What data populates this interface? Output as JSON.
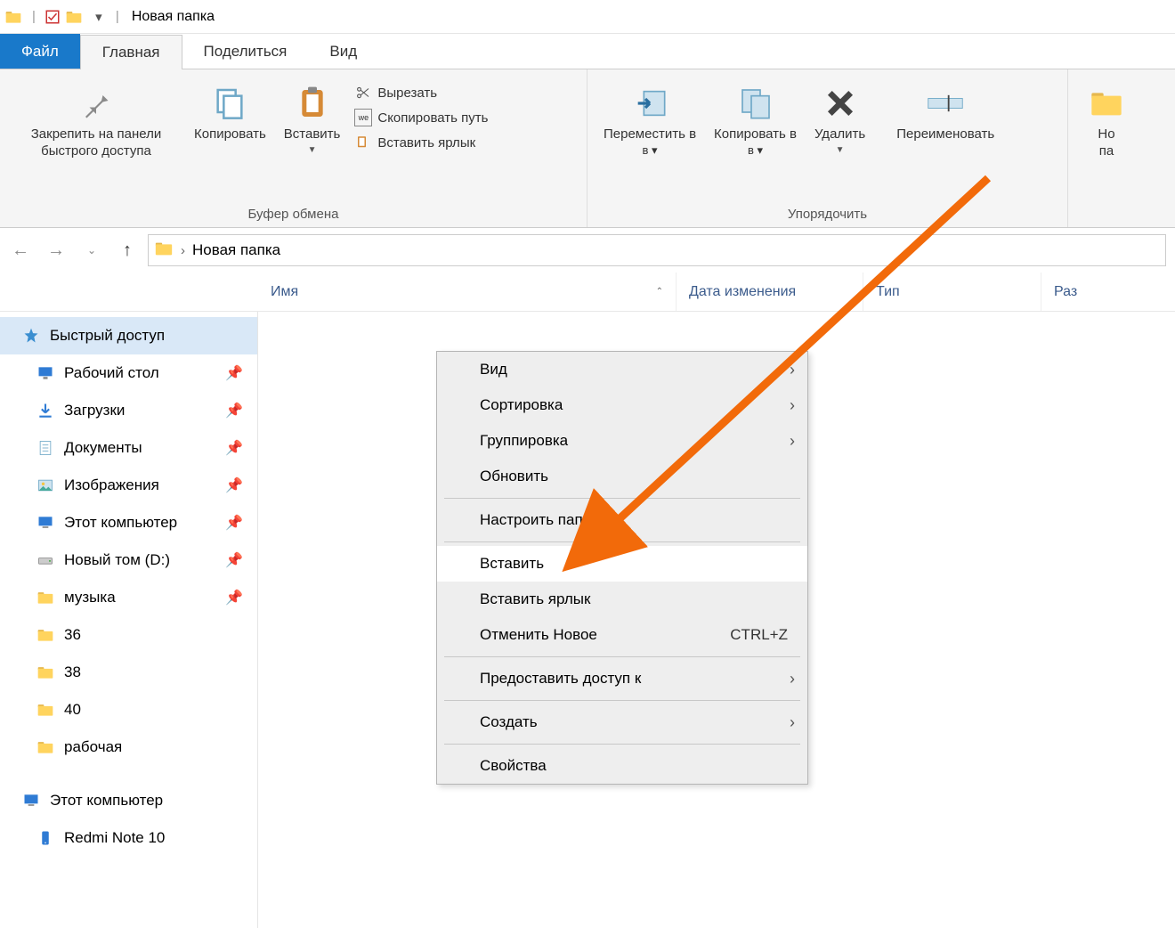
{
  "window": {
    "title": "Новая папка"
  },
  "tabs": {
    "file": "Файл",
    "home": "Главная",
    "share": "Поделиться",
    "view": "Вид"
  },
  "ribbon": {
    "clipboard": {
      "pin": "Закрепить на панели быстрого доступа",
      "copy": "Копировать",
      "paste": "Вставить",
      "cut": "Вырезать",
      "copy_path": "Скопировать путь",
      "paste_shortcut": "Вставить ярлык",
      "group_label": "Буфер обмена"
    },
    "organize": {
      "move_to": "Переместить в",
      "copy_to": "Копировать в",
      "delete": "Удалить",
      "rename": "Переименовать",
      "group_label": "Упорядочить"
    },
    "new": {
      "new_folder_partial": "Но",
      "new_folder_partial2": "па"
    }
  },
  "breadcrumb": {
    "current": "Новая папка"
  },
  "columns": {
    "name": "Имя",
    "date_modified": "Дата изменения",
    "type": "Тип",
    "size": "Раз"
  },
  "sidebar": {
    "quick_access": "Быстрый доступ",
    "desktop": "Рабочий стол",
    "downloads": "Загрузки",
    "documents": "Документы",
    "pictures": "Изображения",
    "this_pc_pinned": "Этот компьютер",
    "new_volume": "Новый том (D:)",
    "music": "музыка",
    "f36": "36",
    "f38": "38",
    "f40": "40",
    "work": "рабочая",
    "this_pc": "Этот компьютер",
    "phone": "Redmi Note 10"
  },
  "context_menu": {
    "view": "Вид",
    "sort": "Сортировка",
    "group": "Группировка",
    "refresh": "Обновить",
    "customize": "Настроить папку…",
    "paste": "Вставить",
    "paste_shortcut": "Вставить ярлык",
    "undo_new": "Отменить Новое",
    "undo_shortcut": "CTRL+Z",
    "give_access": "Предоставить доступ к",
    "create": "Создать",
    "properties": "Свойства"
  }
}
